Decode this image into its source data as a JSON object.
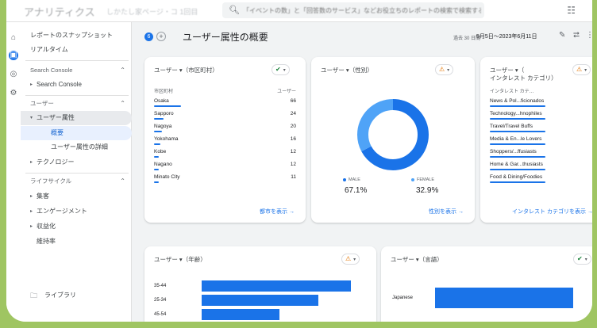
{
  "topbar": {
    "app_name": "アナリティクス",
    "property": "しかたし家ページ・コ 1回目",
    "search_placeholder": "「イベントの数」と「回答数のサービス」などお役立ちのレポートの検索で検索する"
  },
  "sidebar": {
    "items": [
      {
        "label": "レポートのスナップショット"
      },
      {
        "label": "リアルタイム"
      },
      {
        "label": "Search Console"
      },
      {
        "label": "Search Console"
      },
      {
        "label": "ユーザー"
      },
      {
        "label": "ユーザー属性"
      },
      {
        "label": "概要"
      },
      {
        "label": "ユーザー属性の詳細"
      },
      {
        "label": "テクノロジー"
      },
      {
        "label": "ライフサイクル"
      },
      {
        "label": "集客"
      },
      {
        "label": "エンゲージメント"
      },
      {
        "label": "収益化"
      },
      {
        "label": "維持率"
      },
      {
        "label": "ライブラリ"
      }
    ]
  },
  "header": {
    "badge": "6",
    "title": "ユーザー属性の概要",
    "range_label": "過去 30 日間",
    "date_range": "5月5日～2023年6月11日"
  },
  "city_card": {
    "title": "ユーザー ▾（市区町村）",
    "col_dim": "市区町村",
    "col_metric": "ユーザー",
    "rows": [
      {
        "name": "Osaka",
        "value": "66"
      },
      {
        "name": "Sapporo",
        "value": "24"
      },
      {
        "name": "Nagoya",
        "value": "20"
      },
      {
        "name": "Yokohama",
        "value": "16"
      },
      {
        "name": "Kobe",
        "value": "12"
      },
      {
        "name": "Nagano",
        "value": "12"
      },
      {
        "name": "Minato City",
        "value": "11"
      }
    ],
    "link": "都市を表示"
  },
  "gender_card": {
    "title": "ユーザー ▾（性別）",
    "male_label": "MALE",
    "male_pct": "67.1%",
    "female_label": "FEMALE",
    "female_pct": "32.9%",
    "link": "性別を表示"
  },
  "interest_card": {
    "title_line1": "ユーザー ▾（",
    "title_line2": "インタレスト カテゴリ）",
    "col_dim": "インタレスト カテ…",
    "rows": [
      {
        "name": "News & Pol...ficionados"
      },
      {
        "name": "Technology...hnophiles"
      },
      {
        "name": "Travel/Travel Buffs"
      },
      {
        "name": "Media & En...le Lovers"
      },
      {
        "name": "Shoppers/...ffusiasts"
      },
      {
        "name": "Home & Gar...thusiasts"
      },
      {
        "name": "Food & Dining/Foodies"
      }
    ],
    "link": "インタレスト カテゴリを表示"
  },
  "age_card": {
    "title": "ユーザー ▾（年齢）",
    "bars": [
      {
        "label": "35-44"
      },
      {
        "label": "25-34"
      },
      {
        "label": "45-54"
      }
    ]
  },
  "language_card": {
    "title": "ユーザー ▾（言語）",
    "bars": [
      {
        "label": "Japanese"
      }
    ]
  },
  "chart_data": [
    {
      "type": "table",
      "title": "ユーザー（市区町村）",
      "categories": [
        "Osaka",
        "Sapporo",
        "Nagoya",
        "Yokohama",
        "Kobe",
        "Nagano",
        "Minato City"
      ],
      "values": [
        66,
        24,
        20,
        16,
        12,
        12,
        11
      ]
    },
    {
      "type": "pie",
      "title": "ユーザー（性別）",
      "categories": [
        "MALE",
        "FEMALE"
      ],
      "values": [
        67.1,
        32.9
      ]
    },
    {
      "type": "bar",
      "title": "ユーザー（年齢）",
      "categories": [
        "35-44",
        "25-34",
        "45-54"
      ],
      "values": [
        100,
        78,
        52
      ]
    },
    {
      "type": "bar",
      "title": "ユーザー（言語）",
      "categories": [
        "Japanese"
      ],
      "values": [
        100
      ]
    }
  ],
  "colors": {
    "accent": "#1a73e8",
    "female": "#4fa3f7",
    "ok": "#188038",
    "warn": "#e37400"
  }
}
